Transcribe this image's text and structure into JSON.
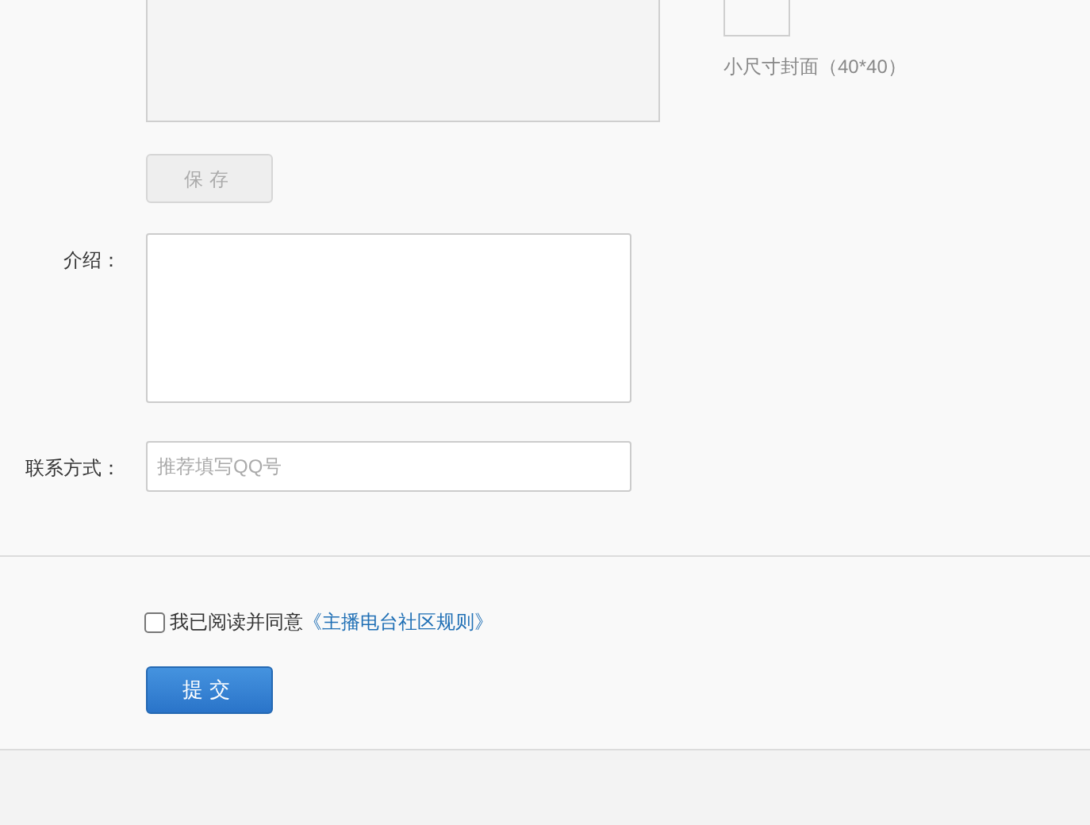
{
  "cover_upload": {
    "small_caption": "小尺寸封面（40*40）",
    "save_button": {
      "label": "保存",
      "disabled": true
    }
  },
  "form": {
    "fields": [
      {
        "label": "介绍：",
        "kind": "textarea"
      },
      {
        "label": "联系方式：",
        "kind": "input",
        "placeholder": "推荐填写QQ号"
      }
    ]
  },
  "agreement": {
    "checked": false,
    "text": "我已阅读并同意",
    "link": "《主播电台社区规则》"
  },
  "submit_button": {
    "label": "提交"
  }
}
